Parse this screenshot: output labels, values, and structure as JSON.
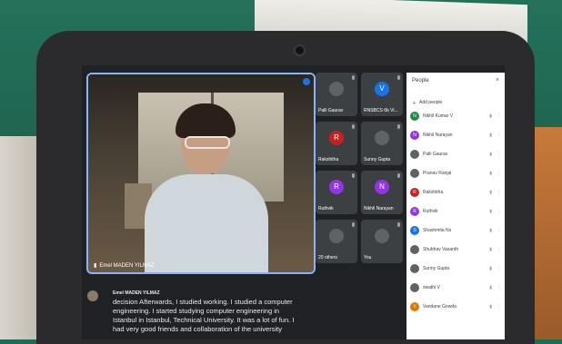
{
  "main_speaker": {
    "name": "Emel MADEN YILMAZ"
  },
  "tiles": [
    {
      "name": "Palli Gaurav",
      "initial": "",
      "color": "#5f6368"
    },
    {
      "name": "RNSBCS 6b Vi...",
      "initial": "V",
      "color": "#1a73e8"
    },
    {
      "name": "Rakshitha",
      "initial": "R",
      "color": "#c5221f"
    },
    {
      "name": "Sunny Gupta",
      "initial": "",
      "color": "#5f6368"
    },
    {
      "name": "Ruthvik",
      "initial": "R",
      "color": "#9334e6"
    },
    {
      "name": "Nikhil Narayan",
      "initial": "N",
      "color": "#9334e6"
    },
    {
      "name": "20 others",
      "initial": "",
      "color": "#5f6368"
    },
    {
      "name": "You",
      "initial": "",
      "color": "#5f6368"
    }
  ],
  "people_panel": {
    "title": "People",
    "close_icon": "×",
    "add_people": "Add people",
    "rows": [
      {
        "initial": "N",
        "name": "Nikhil Kumar V",
        "color": "#1e8e3e"
      },
      {
        "initial": "N",
        "name": "Nikhil Narayan",
        "color": "#9334e6"
      },
      {
        "initial": "",
        "name": "Palli Gaurav",
        "color": "#5f6368"
      },
      {
        "initial": "",
        "name": "Pranav Ranjal",
        "color": "#5f6368"
      },
      {
        "initial": "R",
        "name": "Rakshitha",
        "color": "#c5221f"
      },
      {
        "initial": "R",
        "name": "Ruthvik",
        "color": "#9334e6"
      },
      {
        "initial": "S",
        "name": "Shashmita Ns",
        "color": "#1a73e8"
      },
      {
        "initial": "",
        "name": "Shubhav Vasanth",
        "color": "#5f6368"
      },
      {
        "initial": "",
        "name": "Sunny Gupta",
        "color": "#5f6368"
      },
      {
        "initial": "",
        "name": "swathi V",
        "color": "#5f6368"
      },
      {
        "initial": "V",
        "name": "Vandane Gowda",
        "color": "#e37400"
      }
    ]
  },
  "caption": {
    "speaker": "Emel MADEN YILMAZ",
    "text": "decision Afterwards, I studied working. I studied a computer engineering. I started studying computer engineering in Istanbul in Istanbul, Technical University. It was a lot of fun. I had very good friends and collaboration of the university"
  }
}
